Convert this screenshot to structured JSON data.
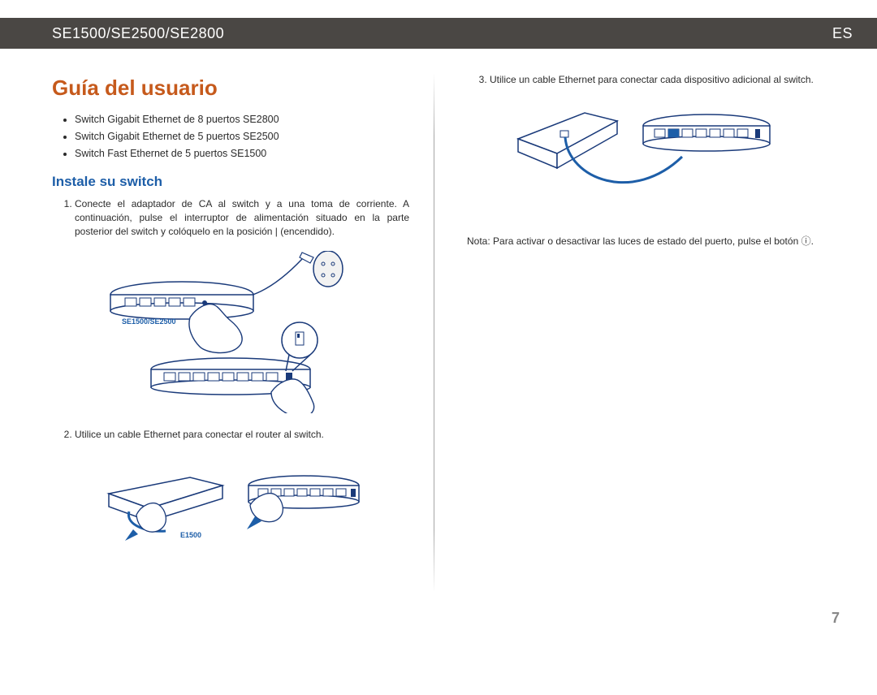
{
  "header": {
    "model": "SE1500/SE2500/SE2800",
    "lang": "ES"
  },
  "left": {
    "title": "Guía del usuario",
    "bullets": [
      "Switch Gigabit Ethernet de 8 puertos SE2800",
      "Switch Gigabit Ethernet de 5 puertos SE2500",
      "Switch Fast Ethernet de 5 puertos SE1500"
    ],
    "subtitle": "Instale su switch",
    "step1": "Conecte el adaptador de CA al switch y a una toma de corriente. A continuación, pulse el interruptor de alimentación situado en la parte posterior del switch y colóquelo en la posición | (encendido).",
    "fig1_caption": "SE1500/SE2500",
    "step2": "Utilice un cable Ethernet para conectar el router al switch.",
    "fig2_caption": "E1500"
  },
  "right": {
    "step3": "Utilice un cable Ethernet para conectar cada dispositivo adicional al switch.",
    "note": "Nota: Para activar o desactivar las luces de estado del puerto, pulse el botón ⓘ."
  },
  "pagenum": "7"
}
